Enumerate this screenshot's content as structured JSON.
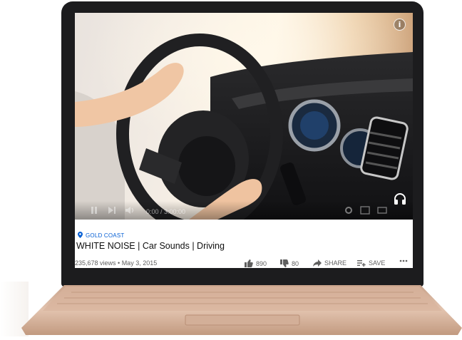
{
  "video": {
    "time_display": "0:00 / 3:00:00"
  },
  "meta": {
    "location": "GOLD COAST",
    "title": "WHITE NOISE | Car Sounds | Driving",
    "views_date": "235,678 views • May 3, 2015",
    "likes": "890",
    "dislikes": "80",
    "share_label": "SHARE",
    "save_label": "SAVE"
  },
  "colors": {
    "accent": "#065fd4",
    "bezel": "#1c1c1e",
    "deck": "#d9b9a3"
  }
}
